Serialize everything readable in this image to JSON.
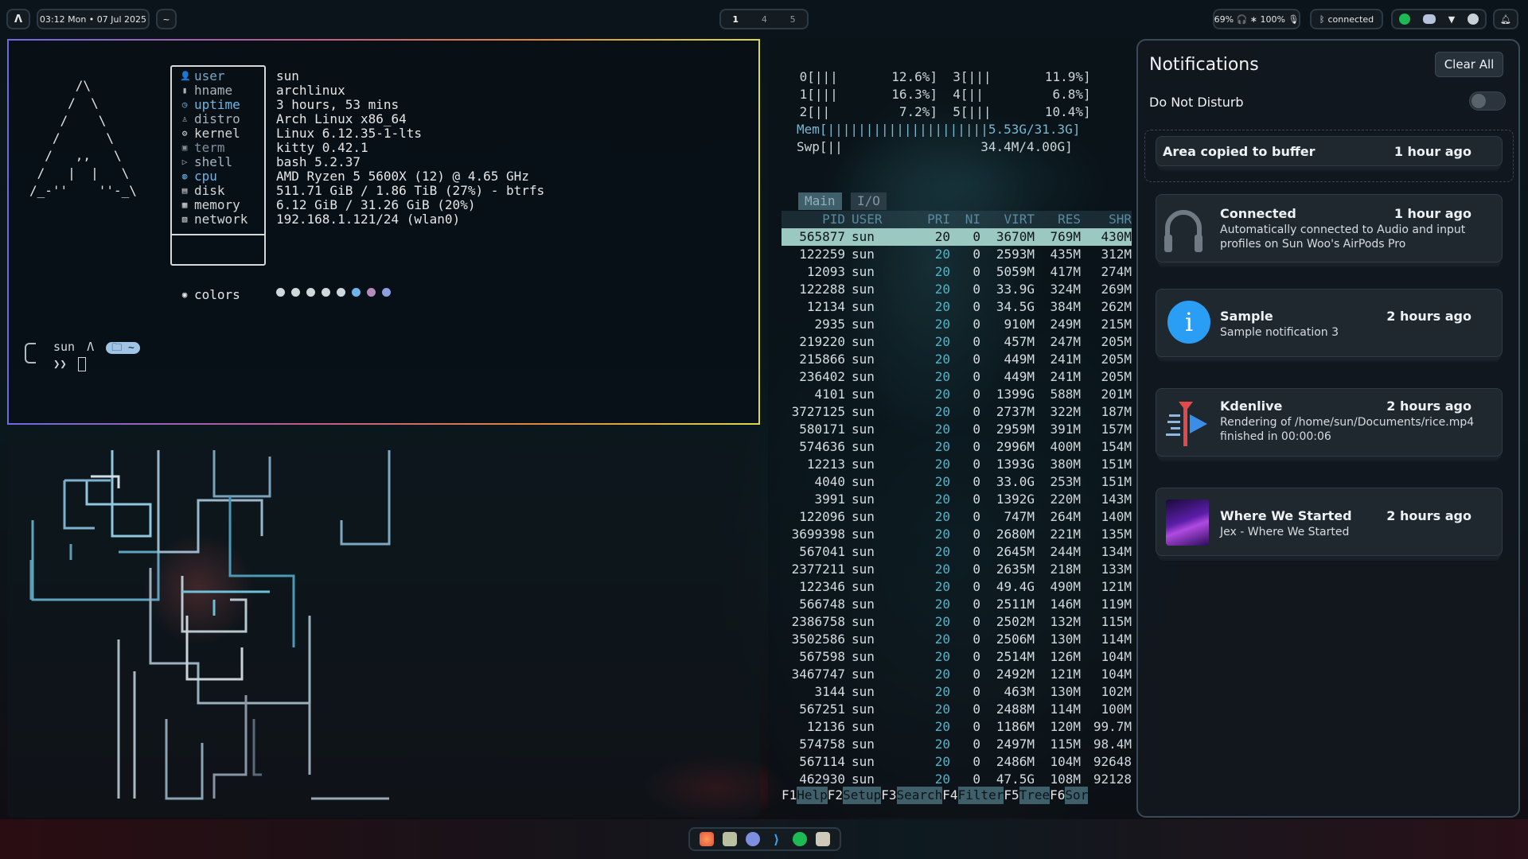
{
  "topbar": {
    "launcher_glyph": "Λ",
    "datetime": "03:12 Mon • 07 Jul 2025",
    "tilde": "~",
    "workspaces": [
      "1",
      "4",
      "5"
    ],
    "status": "69% 🎧 ∗ 100% 🎙",
    "connection": "connected"
  },
  "fastfetch": {
    "logo": "      /\\\n     /  \\\n    /    \\\n   /      \\\n  /   ,,   \\\n /   |  |   \\\n/_-''    ''-_\\",
    "items": [
      {
        "icon": "user-icon",
        "glyph": "👤",
        "label": "user",
        "value": "sun",
        "color": "#7aa7c7"
      },
      {
        "icon": "host-icon",
        "glyph": "▮",
        "label": "hname",
        "value": "archlinux",
        "color": "#a7b3bd"
      },
      {
        "icon": "clock-icon",
        "glyph": "◷",
        "label": "uptime",
        "value": "3 hours, 53 mins",
        "color": "#6bb6e8"
      },
      {
        "icon": "distro-icon",
        "glyph": "♙",
        "label": "distro",
        "value": "Arch Linux x86_64",
        "color": "#a7b3bd"
      },
      {
        "icon": "gear-icon",
        "glyph": "⚙",
        "label": "kernel",
        "value": "Linux 6.12.35-1-lts",
        "color": "#d6d6d6"
      },
      {
        "icon": "terminal-icon",
        "glyph": "▣",
        "label": "term",
        "value": "kitty 0.42.1",
        "color": "#7f8f9b"
      },
      {
        "icon": "shell-icon",
        "glyph": "▷",
        "label": "shell",
        "value": "bash 5.2.37",
        "color": "#a7b3bd"
      },
      {
        "icon": "cpu-icon",
        "glyph": "◍",
        "label": "cpu",
        "value": "AMD Ryzen 5 5600X (12) @ 4.65 GHz",
        "color": "#6bb6e8"
      },
      {
        "icon": "disk-icon",
        "glyph": "▤",
        "label": "disk",
        "value": "511.71 GiB / 1.86 TiB (27%) - btrfs",
        "color": "#d6d6d6"
      },
      {
        "icon": "memory-icon",
        "glyph": "▦",
        "label": "memory",
        "value": "6.12 GiB / 31.26 GiB (20%)",
        "color": "#d6d6d6"
      },
      {
        "icon": "network-icon",
        "glyph": "▧",
        "label": "network",
        "value": "192.168.1.121/24 (wlan0)",
        "color": "#d6d6d6"
      }
    ],
    "colors_label": "colors",
    "colors": [
      "#cfd8dc",
      "#cfd8dc",
      "#cfd8dc",
      "#cfd8dc",
      "#cfd8dc",
      "#6bb6e8",
      "#b58bbd",
      "#8f9fe0"
    ],
    "prompt_user": "sun",
    "prompt_dir": "~",
    "prompt_glyph": "❯❯"
  },
  "htop": {
    "cpu_lines": [
      " 0[|||       12.6%]  3[|||       11.9%]",
      " 1[|||       16.3%]  4[||         6.8%]",
      " 2[||         7.2%]  5[|||       10.4%]",
      "Mem[|||||||||||||||||||||5.53G/31.3G]",
      "Swp[||                  34.4M/4.00G]"
    ],
    "tabs": [
      "Main",
      "I/O"
    ],
    "columns": [
      "PID",
      "USER",
      "PRI",
      "NI",
      "VIRT",
      "RES",
      "SHR"
    ],
    "rows": [
      [
        "565877",
        "sun",
        "20",
        "0",
        "3670M",
        "769M",
        "430M"
      ],
      [
        "122259",
        "sun",
        "20",
        "0",
        "2593M",
        "435M",
        "312M"
      ],
      [
        "12093",
        "sun",
        "20",
        "0",
        "5059M",
        "417M",
        "274M"
      ],
      [
        "122288",
        "sun",
        "20",
        "0",
        "33.9G",
        "324M",
        "269M"
      ],
      [
        "12134",
        "sun",
        "20",
        "0",
        "34.5G",
        "384M",
        "262M"
      ],
      [
        "2935",
        "sun",
        "20",
        "0",
        "910M",
        "249M",
        "215M"
      ],
      [
        "219220",
        "sun",
        "20",
        "0",
        "457M",
        "247M",
        "205M"
      ],
      [
        "215866",
        "sun",
        "20",
        "0",
        "449M",
        "241M",
        "205M"
      ],
      [
        "236402",
        "sun",
        "20",
        "0",
        "449M",
        "241M",
        "205M"
      ],
      [
        "4101",
        "sun",
        "20",
        "0",
        "1399G",
        "588M",
        "201M"
      ],
      [
        "3727125",
        "sun",
        "20",
        "0",
        "2737M",
        "322M",
        "187M"
      ],
      [
        "580171",
        "sun",
        "20",
        "0",
        "2959M",
        "391M",
        "157M"
      ],
      [
        "574636",
        "sun",
        "20",
        "0",
        "2996M",
        "400M",
        "154M"
      ],
      [
        "12213",
        "sun",
        "20",
        "0",
        "1393G",
        "380M",
        "151M"
      ],
      [
        "4040",
        "sun",
        "20",
        "0",
        "33.0G",
        "253M",
        "151M"
      ],
      [
        "3991",
        "sun",
        "20",
        "0",
        "1392G",
        "220M",
        "143M"
      ],
      [
        "122096",
        "sun",
        "20",
        "0",
        "747M",
        "264M",
        "140M"
      ],
      [
        "3699398",
        "sun",
        "20",
        "0",
        "2680M",
        "221M",
        "135M"
      ],
      [
        "567041",
        "sun",
        "20",
        "0",
        "2645M",
        "244M",
        "134M"
      ],
      [
        "2377211",
        "sun",
        "20",
        "0",
        "2635M",
        "218M",
        "133M"
      ],
      [
        "122346",
        "sun",
        "20",
        "0",
        "49.4G",
        "490M",
        "121M"
      ],
      [
        "566748",
        "sun",
        "20",
        "0",
        "2511M",
        "146M",
        "119M"
      ],
      [
        "2386758",
        "sun",
        "20",
        "0",
        "2502M",
        "132M",
        "115M"
      ],
      [
        "3502586",
        "sun",
        "20",
        "0",
        "2506M",
        "130M",
        "114M"
      ],
      [
        "567598",
        "sun",
        "20",
        "0",
        "2514M",
        "126M",
        "104M"
      ],
      [
        "3467747",
        "sun",
        "20",
        "0",
        "2492M",
        "121M",
        "104M"
      ],
      [
        "3144",
        "sun",
        "20",
        "0",
        "463M",
        "130M",
        "102M"
      ],
      [
        "567251",
        "sun",
        "20",
        "0",
        "2488M",
        "114M",
        "100M"
      ],
      [
        "12136",
        "sun",
        "20",
        "0",
        "1186M",
        "120M",
        "99.7M"
      ],
      [
        "574758",
        "sun",
        "20",
        "0",
        "2497M",
        "115M",
        "98.4M"
      ],
      [
        "567114",
        "sun",
        "20",
        "0",
        "2486M",
        "104M",
        "92648"
      ],
      [
        "462930",
        "sun",
        "20",
        "0",
        "47.5G",
        "108M",
        "92128"
      ]
    ],
    "fkeys": [
      {
        "key": "F1",
        "label": "Help"
      },
      {
        "key": "F2",
        "label": "Setup"
      },
      {
        "key": "F3",
        "label": "Search"
      },
      {
        "key": "F4",
        "label": "Filter"
      },
      {
        "key": "F5",
        "label": "Tree"
      },
      {
        "key": "F6",
        "label": "Sor"
      }
    ]
  },
  "notifications": {
    "title": "Notifications",
    "clear_all": "Clear All",
    "dnd_label": "Do Not Disturb",
    "dnd_on": false,
    "items": [
      {
        "title": "Area copied to buffer",
        "time": "1 hour ago",
        "body": "",
        "icon": ""
      },
      {
        "title": "Connected",
        "time": "1 hour ago",
        "body": "Automatically connected to Audio and input profiles on Sun Woo's AirPods Pro",
        "icon": "headphones-icon"
      },
      {
        "title": "Sample",
        "time": "2 hours ago",
        "body": "Sample notification 3",
        "icon": "info-icon",
        "icon_glyph": "i"
      },
      {
        "title": "Kdenlive",
        "time": "2 hours ago",
        "body": "Rendering of /home/sun/Documents/rice.mp4 finished in 00:00:06",
        "icon": "kdenlive-icon"
      },
      {
        "title": "Where We Started",
        "time": "2 hours ago",
        "body": "Jex - Where We Started",
        "icon": "album-art-icon"
      }
    ]
  },
  "dock": {
    "apps": [
      "firefox-icon",
      "files-icon",
      "discord-icon",
      "vscode-icon",
      "spotify-icon",
      "app-icon"
    ]
  }
}
